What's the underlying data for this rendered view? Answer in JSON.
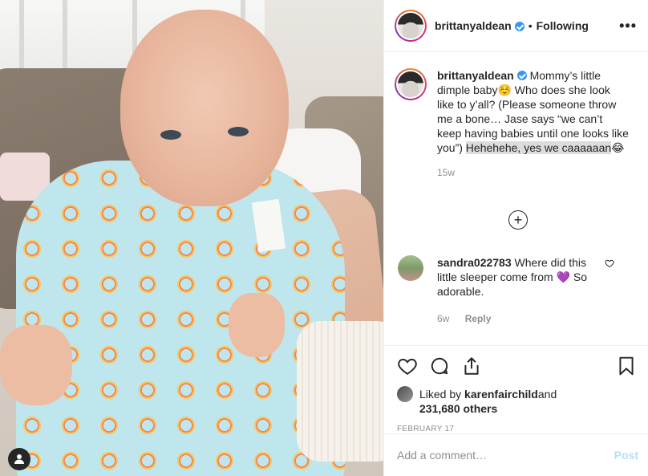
{
  "post": {
    "username": "brittanyaldean",
    "following_label": "Following",
    "dot": "•",
    "more_label": "•••"
  },
  "caption": {
    "username": "brittanyaldean",
    "text_a": "Mommy’s little dimple baby☺️ Who does she look like to y’all? (Please someone throw me a bone… Jase says “we can’t keep having babies until one looks like you”) ",
    "text_highlight": "Hehehehe, yes we caaaaaan",
    "text_end": "😂",
    "time": "15w"
  },
  "comment": {
    "username": "sandra022783",
    "text": " Where did this little sleeper come from 💜 So adorable.",
    "time": "6w",
    "reply_label": "Reply"
  },
  "likes": {
    "prefix": "Liked by ",
    "user": "karenfairchild",
    "and": " and",
    "count": "231,680 others"
  },
  "date": "FEBRUARY 17",
  "add_comment": {
    "placeholder": "Add a comment…",
    "post_label": "Post"
  },
  "colors": {
    "verified": "#3897f0",
    "post_disabled": "#b2dffc",
    "muted": "#8e8e8e"
  },
  "icons": [
    "heart-icon",
    "comment-icon",
    "share-icon",
    "bookmark-icon",
    "plus-circle-icon",
    "user-tag-icon",
    "more-icon"
  ]
}
